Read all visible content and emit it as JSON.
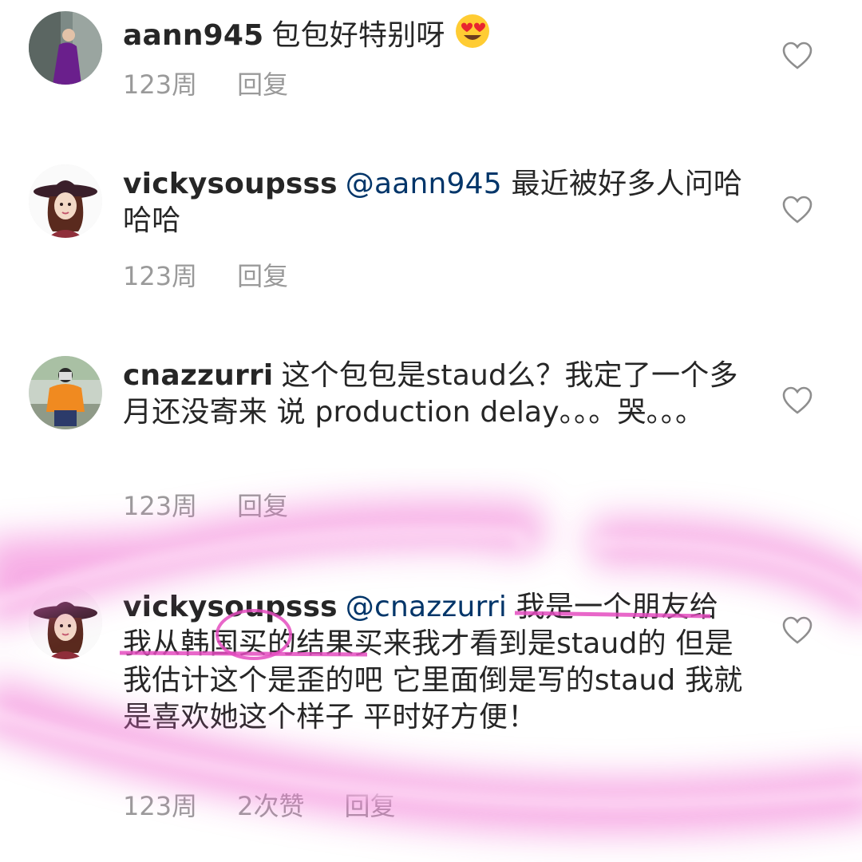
{
  "colors": {
    "text": "#262626",
    "meta": "#9a9a9a",
    "mention": "#003569",
    "highlight": "#f06bd0"
  },
  "comments": [
    {
      "username": "aann945",
      "mention": "",
      "text": "包包好特别呀",
      "emoji": "heart-eyes-emoji",
      "time": "123周",
      "likes": "",
      "reply": "回复"
    },
    {
      "username": "vickysoupsss",
      "mention": "@aann945",
      "text": "最近被好多人问哈哈哈",
      "time": "123周",
      "likes": "",
      "reply": "回复"
    },
    {
      "username": "cnazzurri",
      "mention": "",
      "text": "这个包包是staud么？我定了一个多月还没寄来 说 production delay。。。哭。。。",
      "time": "123周",
      "likes": "",
      "reply": "回复"
    },
    {
      "username": "vickysoupsss",
      "mention": "@cnazzurri",
      "text": "我是一个朋友给我从韩国买的结果买来我才看到是staud的 但是我估计这个是歪的吧 它里面倒是写的staud 我就是喜欢她这个样子 平时好方便！",
      "time": "123周",
      "likes": "2次赞",
      "reply": "回复"
    }
  ]
}
